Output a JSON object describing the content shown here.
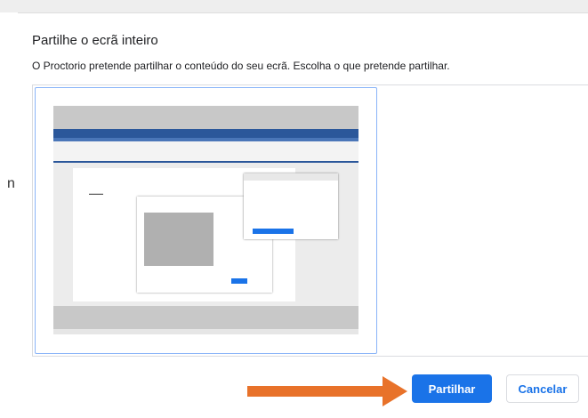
{
  "background_char": "n",
  "dialog": {
    "title": "Partilhe o ecrã inteiro",
    "description": "O Proctorio pretende partilhar o conteúdo do seu ecrã. Escolha o que pretende partilhar.",
    "share_label": "Partilhar",
    "cancel_label": "Cancelar"
  },
  "colors": {
    "primary": "#1a73e8",
    "arrow": "#e8722a",
    "selected_border": "#8ab4f8"
  },
  "icons": {
    "annotation_arrow": "arrow-right-icon"
  }
}
